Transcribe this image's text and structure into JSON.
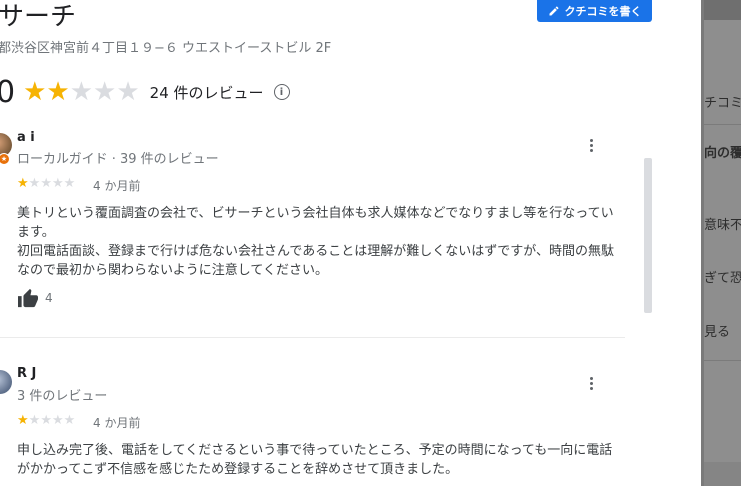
{
  "header": {
    "title": "サーチ",
    "address": "都渋谷区神宮前４丁目１９−６ ウエストイーストビル 2F",
    "write_review_label": "クチコミを書く"
  },
  "summary": {
    "rating": "0",
    "stars_filled": 2,
    "stars_total": 5,
    "review_count": "24 件のレビュー",
    "info_icon": "i"
  },
  "reviews": [
    {
      "name": "a i",
      "meta": "ローカルガイド · 39 件のレビュー",
      "stars_filled": 1,
      "date": "4 か月前",
      "paragraphs": [
        "美トリという覆面調査の会社で、ビサーチという会社自体も求人媒体などでなりすまし等を行なっています。",
        "初回電話面談、登録まで行けば危ない会社さんであることは理解が難しくないはずですが、時間の無駄なので最初から関わらないように注意してください。"
      ],
      "likes": "4"
    },
    {
      "name": "R J",
      "meta": "3 件のレビュー",
      "stars_filled": 1,
      "date": "4 か月前",
      "paragraphs": [
        "申し込み完了後、電話をしてくださるという事で待っていたところ、予定の時間になっても一向に電話がかかってこず不信感を感じたため登録することを辞めさせて頂きました。"
      ]
    }
  ],
  "side_panel": {
    "lines": [
      "チコミ",
      "向の覆面",
      "意味不明",
      "ぎて恐ら",
      "見る"
    ]
  }
}
